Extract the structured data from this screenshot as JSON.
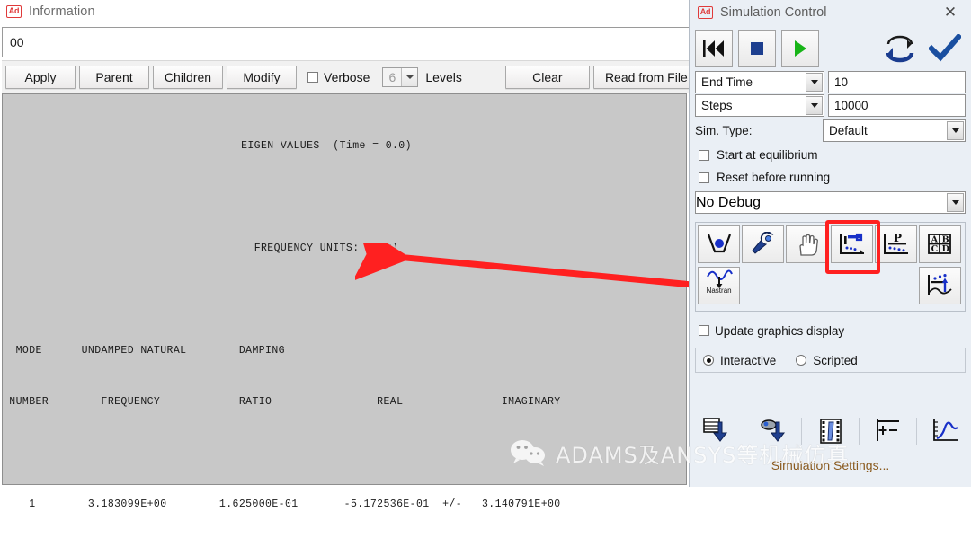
{
  "info_window": {
    "app_icon": "ad-icon",
    "title": "Information",
    "field_value": "00",
    "toolbar": {
      "apply": "Apply",
      "parent": "Parent",
      "children": "Children",
      "modify": "Modify",
      "verbose": "Verbose",
      "levels_value": "6",
      "levels_label": "Levels",
      "clear": "Clear",
      "read_from_file": "Read from File"
    },
    "report": {
      "heading1": "EIGEN VALUES  (Time = 0.0)",
      "heading2": "FREQUENCY UNITS:  (Hz)",
      "header_line1": "  MODE      UNDAMPED NATURAL        DAMPING",
      "header_line2": " NUMBER        FREQUENCY            RATIO                REAL               IMAGINARY",
      "row1": "    1        3.183099E+00        1.625000E-01       -5.172536E-01  +/-   3.140791E+00"
    }
  },
  "sim_panel": {
    "app_icon": "ad-icon",
    "title": "Simulation Control",
    "close_label": "✕",
    "player": {
      "rewind": "rewind-icon",
      "stop": "stop-icon",
      "play": "play-icon",
      "reset": "reset-loop-icon",
      "apply": "checkmark-icon"
    },
    "fields": [
      {
        "combo_label": "End Time",
        "value": "10"
      },
      {
        "combo_label": "Steps",
        "value": "10000"
      }
    ],
    "sim_type": {
      "label": "Sim. Type:",
      "value": "Default"
    },
    "checkboxes": [
      {
        "label": "Start at equilibrium",
        "checked": false
      },
      {
        "label": "Reset before running",
        "checked": false
      }
    ],
    "debug": {
      "value": "No Debug"
    },
    "icon_grid": {
      "row1": [
        {
          "name": "equilibrium-icon",
          "highlighted": false
        },
        {
          "name": "wrench-icon",
          "highlighted": false
        },
        {
          "name": "hand-manipulate-icon",
          "highlighted": false
        },
        {
          "name": "linear-modes-icon",
          "highlighted": true
        },
        {
          "name": "p-sensitivity-icon",
          "highlighted": false
        },
        {
          "name": "abcd-matrix-icon",
          "highlighted": false
        }
      ],
      "row2": [
        {
          "name": "nastran-export-icon",
          "label": "Nastran",
          "highlighted": false
        },
        {
          "name": "vibration-plot-icon",
          "highlighted": false
        }
      ]
    },
    "update_graphics": {
      "label": "Update graphics display",
      "checked": false
    },
    "mode": {
      "interactive": "Interactive",
      "scripted": "Scripted",
      "selected": "Interactive"
    },
    "bottom_icons": [
      "save-results-icon",
      "reload-results-icon",
      "animation-film-icon",
      "plus-minus-icon",
      "plot-curve-icon"
    ],
    "settings_link": "Simulation Settings..."
  },
  "annotation": {
    "arrow_color": "#ff2020",
    "highlight_color": "#ff2020",
    "arrow_name": "red-annotation-arrow"
  },
  "watermark": {
    "logo": "wechat-logo",
    "text": "ADAMS及ANSYS等机械仿真"
  }
}
